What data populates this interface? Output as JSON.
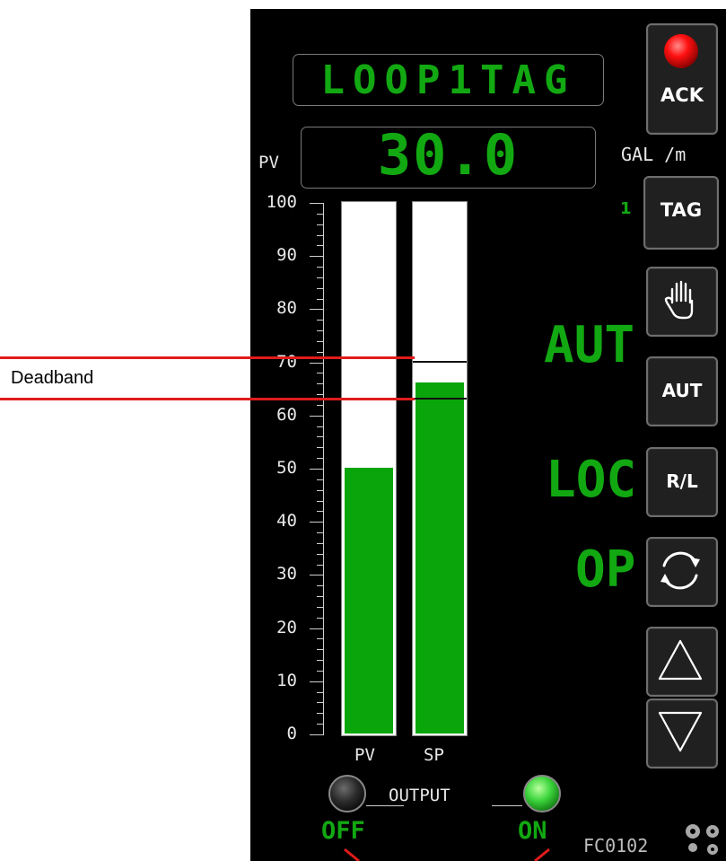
{
  "faceplate": {
    "tag_name": "LOOP1TAG",
    "pv_label": "PV",
    "pv_value": "30.0",
    "units": "GAL /m",
    "device_id": "FC0102"
  },
  "scale": {
    "min": 0,
    "max": 100,
    "ticks": [
      "100",
      "90",
      "80",
      "70",
      "60",
      "50",
      "40",
      "30",
      "20",
      "10",
      "0"
    ]
  },
  "bars": {
    "pv": {
      "label": "PV",
      "value": 50
    },
    "sp": {
      "label": "SP",
      "value": 66,
      "deadband_high": 70,
      "deadband_low": 63
    }
  },
  "buttons": {
    "ack": "ACK",
    "tag": "TAG",
    "aut": "AUT",
    "rl": "R/L"
  },
  "status": {
    "tag_count": "1",
    "mode": "AUT",
    "location": "LOC",
    "output_mode": "OP"
  },
  "output": {
    "label": "OUTPUT",
    "off_label": "OFF",
    "on_label": "ON",
    "state": "on"
  },
  "annotation": {
    "deadband_label": "Deadband"
  },
  "colors": {
    "green": "#12a812",
    "bar_fill": "#0aa50a",
    "alarm_led": "#ff1010",
    "deadband_line": "#e11b1b"
  }
}
